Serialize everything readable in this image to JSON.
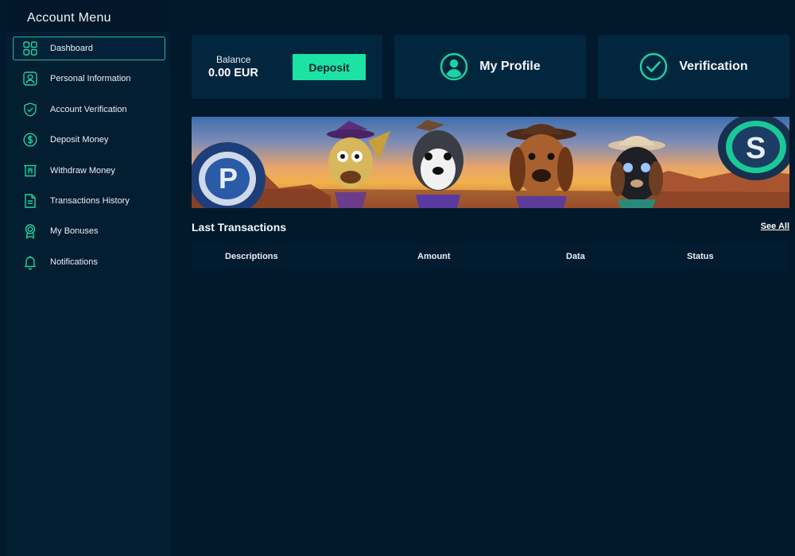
{
  "sidebar": {
    "title": "Account Menu",
    "items": [
      {
        "label": "Dashboard",
        "icon": "grid-icon",
        "active": true
      },
      {
        "label": "Personal Information",
        "icon": "user-card-icon"
      },
      {
        "label": "Account Verification",
        "icon": "shield-check-icon"
      },
      {
        "label": "Deposit Money",
        "icon": "dollar-coin-icon"
      },
      {
        "label": "Withdraw Money",
        "icon": "withdraw-icon"
      },
      {
        "label": "Transactions History",
        "icon": "document-icon"
      },
      {
        "label": "My Bonuses",
        "icon": "award-icon"
      },
      {
        "label": "Notifications",
        "icon": "bell-icon"
      }
    ]
  },
  "cards": {
    "balance_label": "Balance",
    "balance_value": "0.00 EUR",
    "deposit_label": "Deposit",
    "profile_label": "My Profile",
    "verification_label": "Verification"
  },
  "transactions": {
    "title": "Last Transactions",
    "see_all": "See All",
    "columns": [
      "Descriptions",
      "Amount",
      "Data",
      "Status"
    ]
  },
  "colors": {
    "background": "#01192b",
    "sidebar": "#031d31",
    "card": "#03263f",
    "accent": "#1ce3a3",
    "icon": "#1fd3a0"
  }
}
